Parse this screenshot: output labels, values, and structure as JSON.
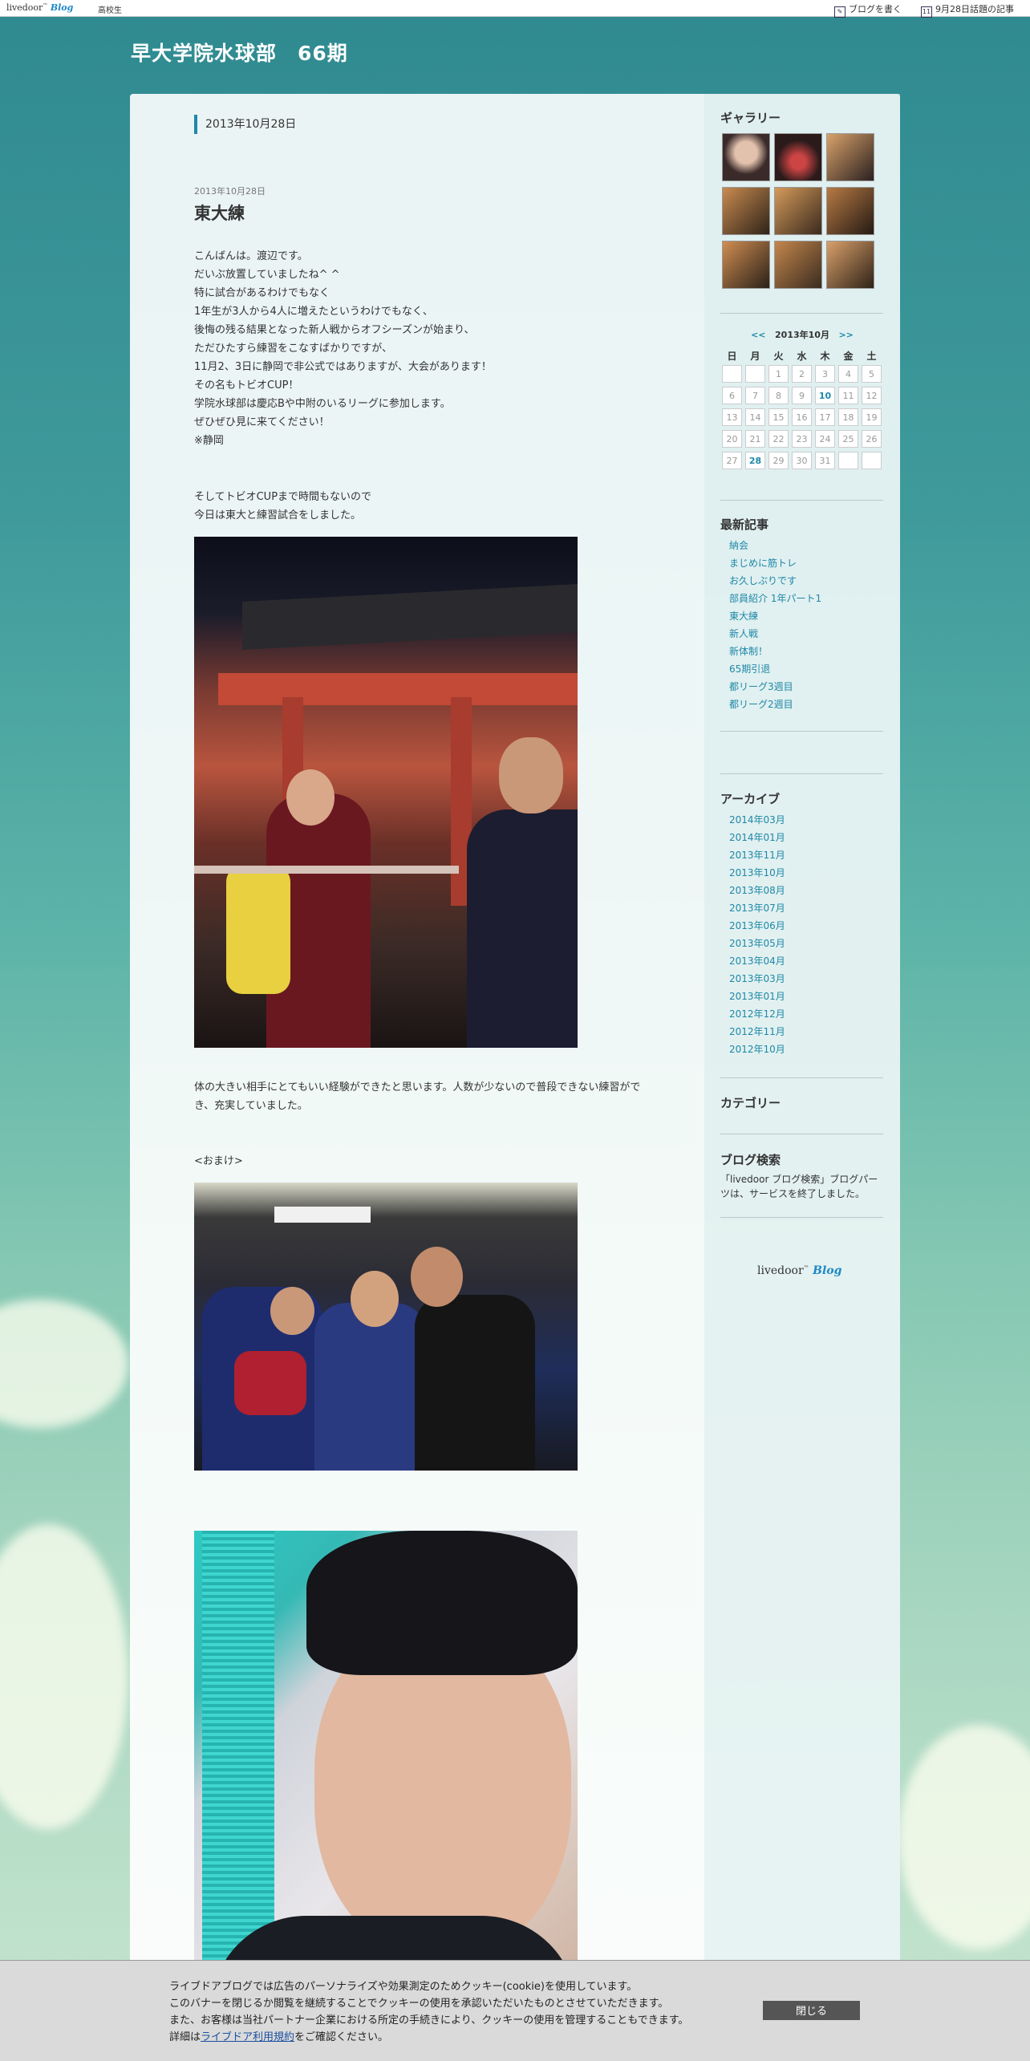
{
  "topbar": {
    "logo_main": "livedoor",
    "logo_blog": "Blog",
    "category": "高校生",
    "write_label": "ブログを書く",
    "topic_label": "9月28日話題の記事"
  },
  "blog": {
    "title": "早大学院水球部　66期"
  },
  "post": {
    "date_header": "2013年10月28日",
    "date": "2013年10月28日",
    "title": "東大練",
    "paragraph1": [
      "こんばんは。渡辺です。",
      "だいぶ放置していましたね^ ^",
      "特に試合があるわけでもなく",
      "1年生が3人から4人に増えたというわけでもなく、",
      "後悔の残る結果となった新人戦からオフシーズンが始まり、",
      "ただひたすら練習をこなすばかりですが、",
      "11月2、3日に静岡で非公式ではありますが、大会があります！",
      "その名もトビオCUP！",
      "学院水球部は慶応Bや中附のいるリーグに参加します。",
      "ぜひぜひ見に来てください！",
      "※静岡"
    ],
    "paragraph2": [
      "そしてトビオCUPまで時間もないので",
      "今日は東大と練習試合をしました。"
    ],
    "paragraph3": "体の大きい相手にとてもいい経験ができたと思います。人数が少ないので普段できない練習ができ、充実していました。",
    "paragraph4": "<おまけ>"
  },
  "sidebar": {
    "gallery_title": "ギャラリー",
    "calendar": {
      "prev": "<<",
      "month": "2013年10月",
      "next": ">>",
      "weekdays": [
        "日",
        "月",
        "火",
        "水",
        "木",
        "金",
        "土"
      ],
      "weeks": [
        [
          "",
          "",
          "1",
          "2",
          "3",
          "4",
          "5"
        ],
        [
          "6",
          "7",
          "8",
          "9",
          "10",
          "11",
          "12"
        ],
        [
          "13",
          "14",
          "15",
          "16",
          "17",
          "18",
          "19"
        ],
        [
          "20",
          "21",
          "22",
          "23",
          "24",
          "25",
          "26"
        ],
        [
          "27",
          "28",
          "29",
          "30",
          "31",
          "",
          ""
        ]
      ],
      "linked_days": [
        "10",
        "28"
      ]
    },
    "recent_title": "最新記事",
    "recent": [
      "納会",
      "まじめに筋トレ",
      "お久しぶりです",
      "部員紹介 1年パート1",
      "東大練",
      "新人戦",
      "新体制！",
      "65期引退",
      "都リーグ3週目",
      "都リーグ2週目"
    ],
    "archive_title": "アーカイブ",
    "archives": [
      "2014年03月",
      "2014年01月",
      "2013年11月",
      "2013年10月",
      "2013年08月",
      "2013年07月",
      "2013年06月",
      "2013年05月",
      "2013年04月",
      "2013年03月",
      "2013年01月",
      "2012年12月",
      "2012年11月",
      "2012年10月"
    ],
    "category_title": "カテゴリー",
    "search_title": "ブログ検索",
    "search_text": "「livedoor ブログ検索」ブログパーツは、サービスを終了しました。",
    "footer_logo_main": "livedoor",
    "footer_logo_blog": "Blog"
  },
  "cookie": {
    "line1": "ライブドアブログでは広告のパーソナライズや効果測定のためクッキー(cookie)を使用しています。",
    "line2": "このバナーを閉じるか閲覧を継続することでクッキーの使用を承認いただいたものとさせていただきます。",
    "line3": "また、お客様は当社パートナー企業における所定の手続きにより、クッキーの使用を管理することもできます。",
    "line4_prefix": "詳細は",
    "line4_link": "ライブドア利用規約",
    "line4_suffix": "をご確認ください。",
    "close_label": "閉じる"
  },
  "colors": {
    "accent": "#1e88a8",
    "header_text": "#ffffff"
  }
}
